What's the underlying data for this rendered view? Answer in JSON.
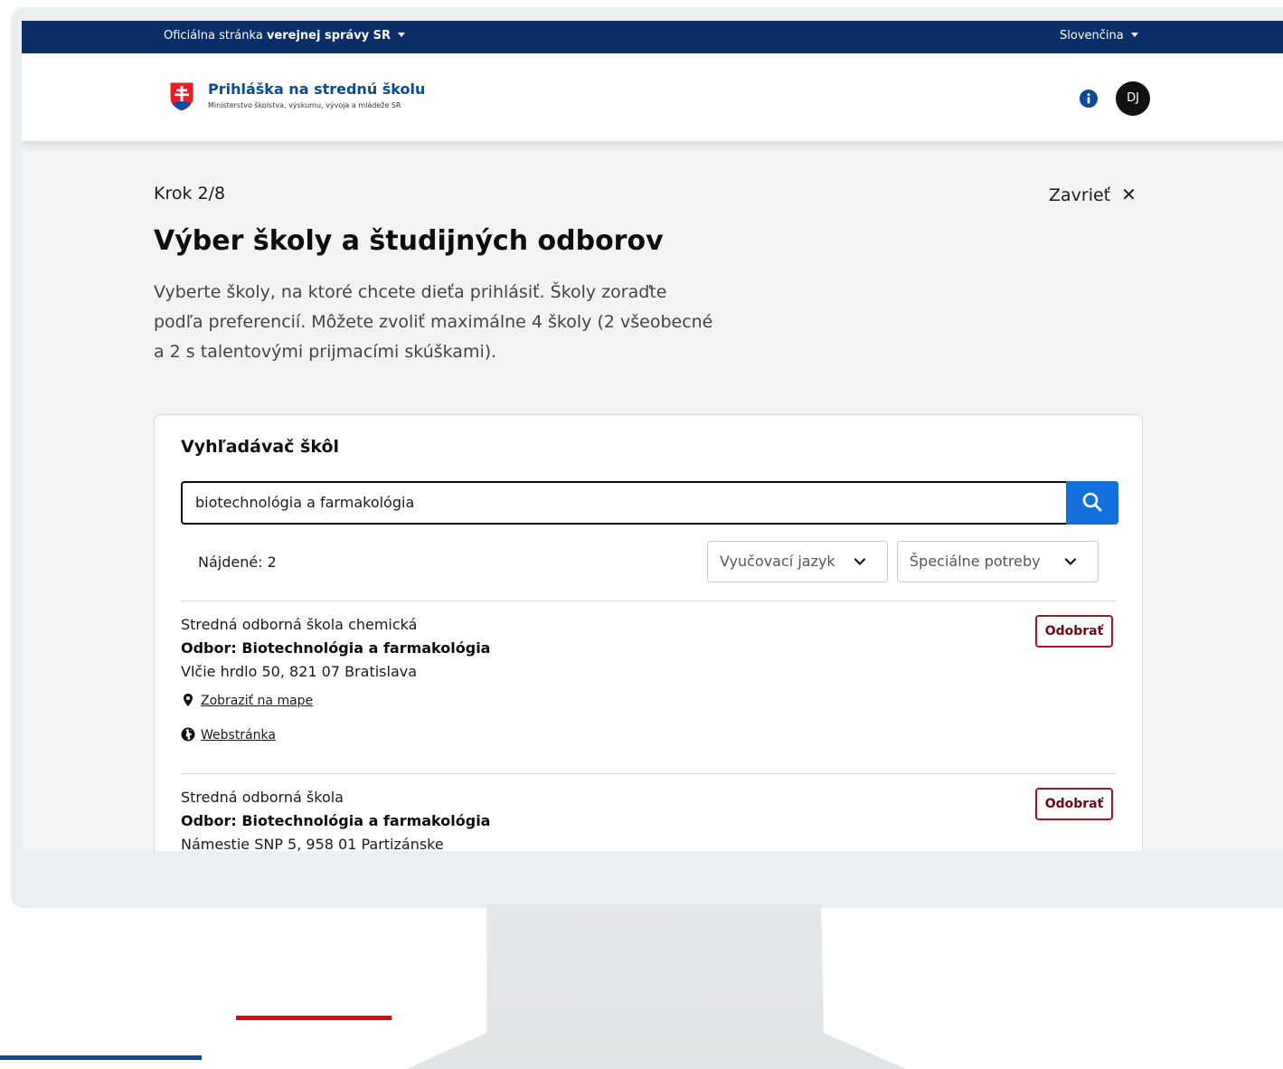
{
  "topbar": {
    "official_prefix": "Oficiálna stránka",
    "official_bold": "verejnej správy SR",
    "language": "Slovenčina"
  },
  "header": {
    "app_title": "Prihláška na strednú školu",
    "app_subtitle": "Ministerstvo školstva, výskumu, vývoja a mládeže SR",
    "avatar_initials": "DJ"
  },
  "page": {
    "step": "Krok 2/8",
    "close_label": "Zavrieť",
    "title": "Výber školy a študijných odborov",
    "description": "Vyberte školy, na ktoré chcete dieťa prihlásiť. Školy zoraďte podľa preferencií. Môžete zvoliť maximálne 4 školy (2 všeobecné a 2 s talentovými prijmacími skúškami)."
  },
  "search": {
    "card_title": "Vyhľadávač škôl",
    "query": "biotechnológia a farmakológia",
    "found": "Nájdené: 2",
    "filter_language": "Vyučovací jazyk",
    "filter_needs": "Špeciálne potreby"
  },
  "results": [
    {
      "school": "Stredná odborná škola chemická",
      "field": "Odbor: Biotechnológia a farmakológia",
      "address": "Vlčie hrdlo 50, 821 07 Bratislava",
      "map_link": "Zobraziť na mape",
      "web_link": "Webstránka",
      "action": "Odobrať"
    },
    {
      "school": "Stredná odborná škola",
      "field": "Odbor: Biotechnológia a farmakológia",
      "address": "Námestie SNP 5, 958 01 Partizánske",
      "action": "Odobrať"
    }
  ],
  "colors": {
    "topbar": "#0a2f66",
    "brand_blue": "#0b4a94",
    "search_button": "#1470dd",
    "remove_border": "#a4162c",
    "accent_red": "#e30613"
  }
}
